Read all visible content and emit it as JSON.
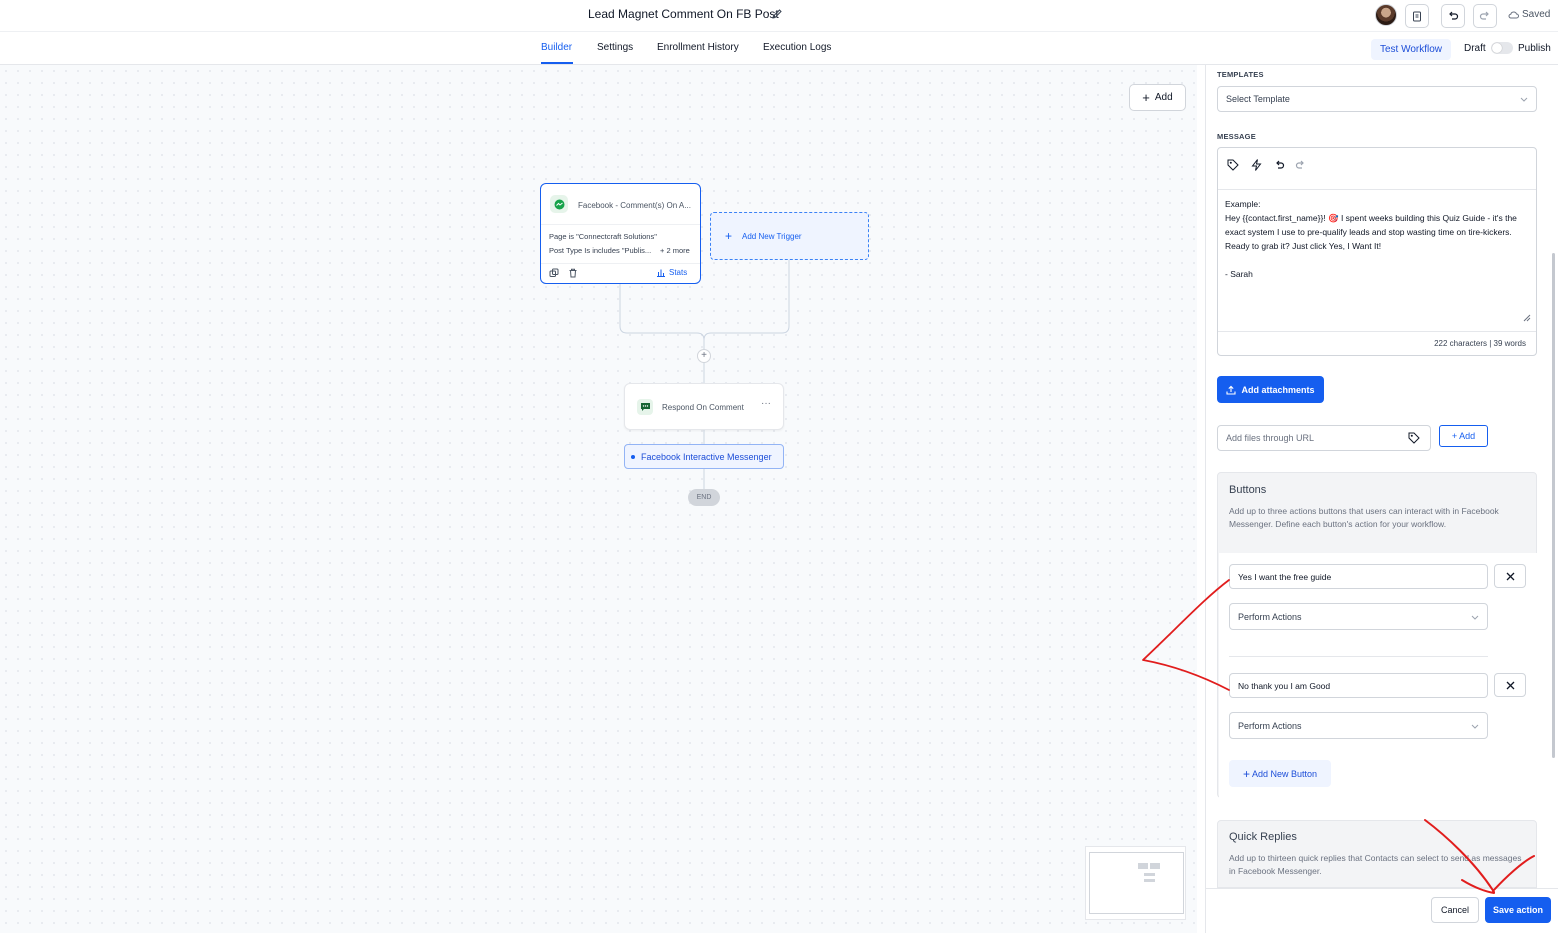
{
  "header": {
    "workflow_title": "Lead Magnet Comment On FB Post",
    "saved_label": "Saved"
  },
  "tabs": [
    {
      "label": "Builder",
      "active": true
    },
    {
      "label": "Settings",
      "active": false
    },
    {
      "label": "Enrollment History",
      "active": false
    },
    {
      "label": "Execution Logs",
      "active": false
    }
  ],
  "actions": {
    "test_workflow": "Test Workflow",
    "draft_label": "Draft",
    "publish_label": "Publish",
    "publish_enabled": false
  },
  "canvas": {
    "add_label": "Add",
    "trigger": {
      "title": "Facebook - Comment(s) On A...",
      "condition_1": "Page is \"Connectcraft Solutions\"",
      "condition_2": "Post Type Is includes \"Publis...",
      "more": "+ 2 more",
      "stats_label": "Stats"
    },
    "add_trigger_label": "Add New Trigger",
    "action_node": "Respond On Comment",
    "action_more": "···",
    "branch_label": "Facebook Interactive Messenger",
    "end_label": "END"
  },
  "panel": {
    "templates_label": "TEMPLATES",
    "template_placeholder": "Select Template",
    "message_label": "MESSAGE",
    "message_text": "Example:\nHey {{contact.first_name}}! 🎯 I spent weeks building this Quiz Guide - it's the exact system I use to pre-qualify leads and stop wasting time on tire-kickers. Ready to grab it? Just click Yes, I Want It!\n\n- Sarah",
    "char_count": "222 characters | 39 words",
    "attach_label": "Add attachments",
    "url_placeholder": "Add files through URL",
    "url_add_label": "+ Add",
    "buttons_title": "Buttons",
    "buttons_desc": "Add up to three actions buttons that users can interact with in Facebook Messenger. Define each button's action for your workflow.",
    "buttons": [
      {
        "text": "Yes I want the free guide",
        "action": "Perform Actions"
      },
      {
        "text": "No thank you I am Good",
        "action": "Perform Actions"
      }
    ],
    "add_new_button": "Add New Button",
    "quick_replies_title": "Quick Replies",
    "quick_replies_desc": "Add up to thirteen quick replies that Contacts can select to send as messages in Facebook Messenger.",
    "cancel_label": "Cancel",
    "save_label": "Save action"
  },
  "colors": {
    "primary": "#155eef",
    "annotation": "#e11d1d"
  }
}
